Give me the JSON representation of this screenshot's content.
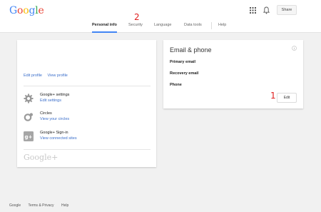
{
  "header": {
    "logo": "Google",
    "share_label": "Share",
    "tabs": [
      {
        "label": "Personal info"
      },
      {
        "label": "Security"
      },
      {
        "label": "Language"
      },
      {
        "label": "Data tools"
      },
      {
        "label": "Help"
      }
    ],
    "accent_color": "#4285f4"
  },
  "annotations": {
    "tab_marker": "2",
    "edit_marker": "1"
  },
  "left_card": {
    "edit_profile": "Edit profile",
    "view_profile": "View profile",
    "items": [
      {
        "icon": "gear-icon",
        "title": "Google+ settings",
        "link": "Edit settings"
      },
      {
        "icon": "circles-icon",
        "title": "Circles",
        "link": "View your circles"
      },
      {
        "icon": "google-plus-icon",
        "title": "Google+ Sign-in",
        "link": "View connected sites"
      }
    ],
    "brand": "Google+"
  },
  "right_card": {
    "title": "Email & phone",
    "primary_email": "Primary email",
    "recovery_email": "Recovery email",
    "phone": "Phone",
    "edit_label": "Edit"
  },
  "footer": {
    "google": "Google",
    "terms": "Terms & Privacy",
    "help": "Help"
  }
}
